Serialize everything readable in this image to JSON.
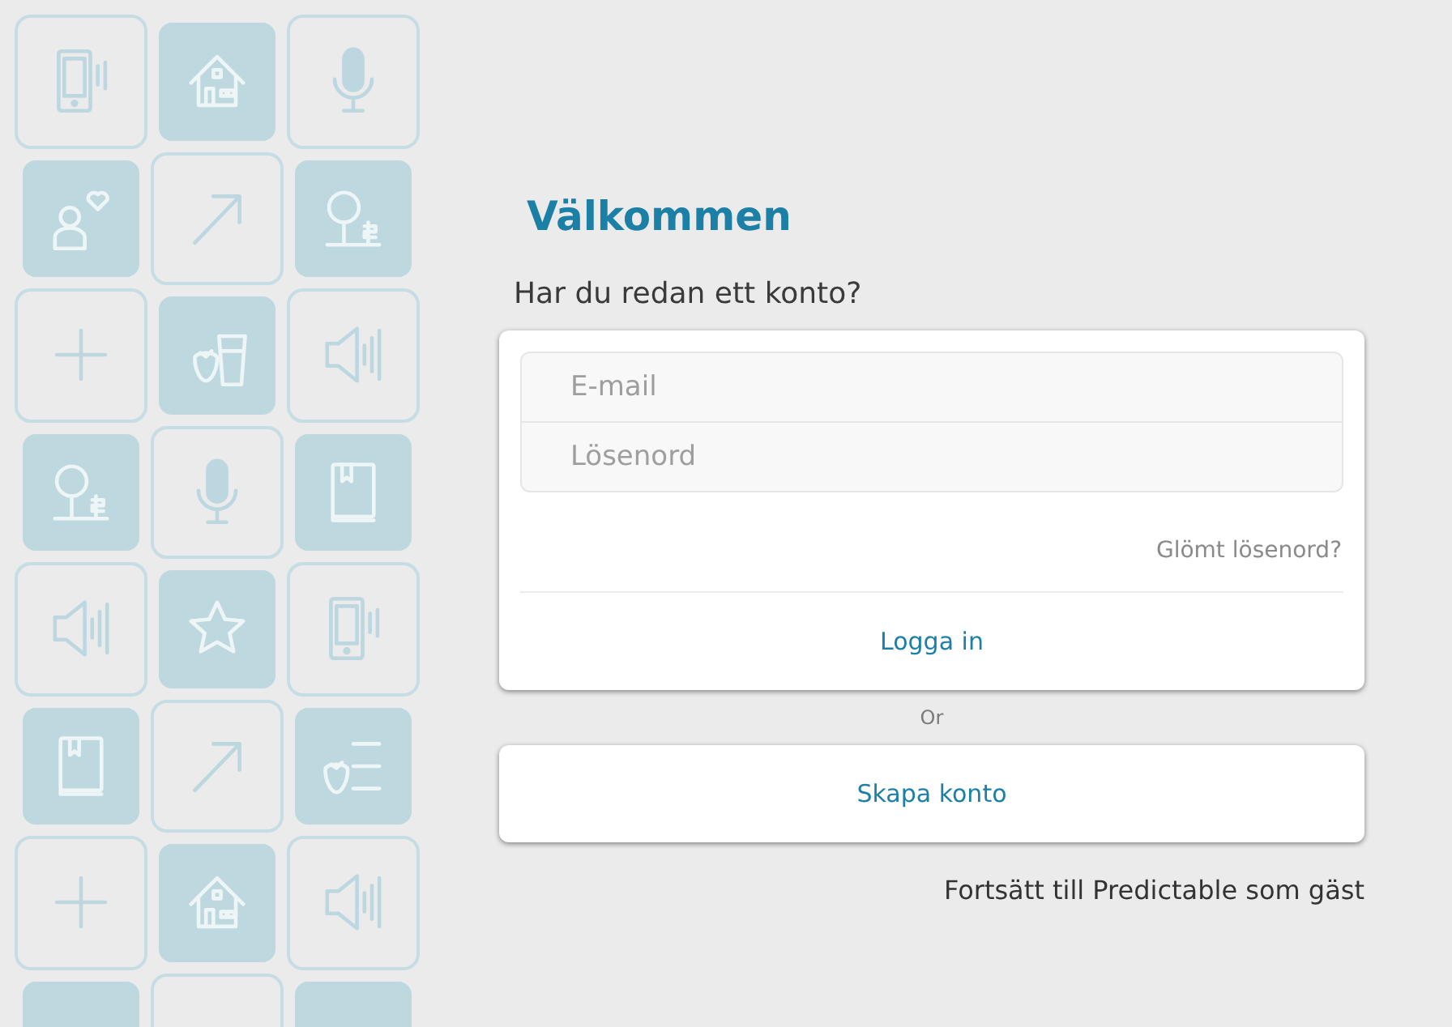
{
  "welcome_title": "Välkommen",
  "login_prompt": "Har du redan ett konto?",
  "login_form": {
    "fields": [
      {
        "placeholder": "E-mail"
      },
      {
        "placeholder": "Lösenord"
      }
    ],
    "forgot_link": "Glömt lösenord?",
    "login_button": "Logga in"
  },
  "separator": "Or",
  "create_account_button": "Skapa konto",
  "guest_link": "Fortsätt till Predictable som gäst"
}
